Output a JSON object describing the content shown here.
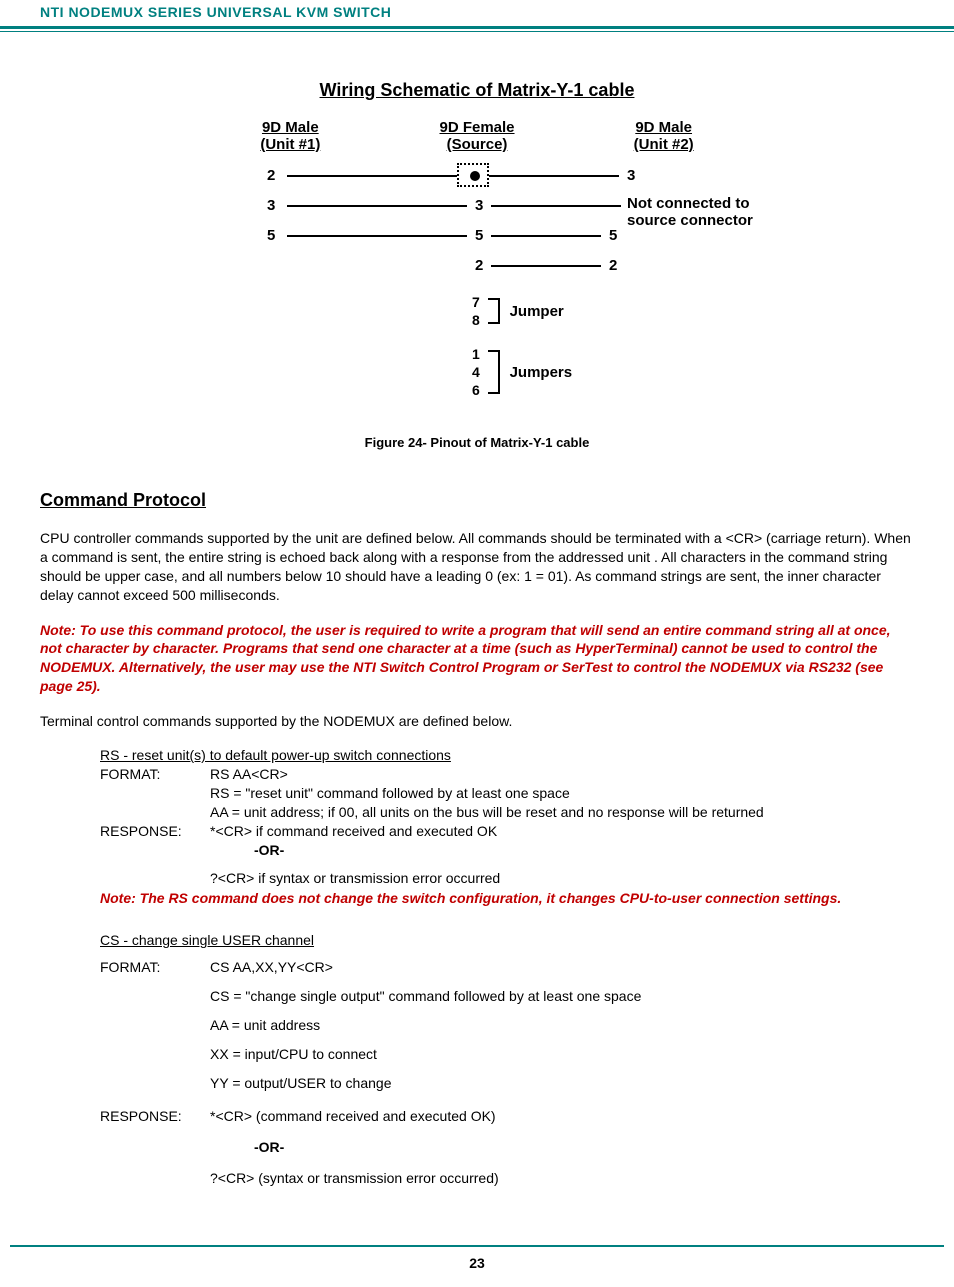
{
  "header": "NTI NODEMUX SERIES UNIVERSAL KVM SWITCH",
  "schematic": {
    "title": "Wiring Schematic of Matrix-Y-1 cable",
    "cols": {
      "c1a": "9D Male",
      "c1b": "(Unit #1)",
      "c2a": "9D Female",
      "c2b": "(Source)",
      "c3a": "9D Male",
      "c3b": "(Unit #2)"
    },
    "side_note_1": "Not connected to",
    "side_note_2": "source connector",
    "jumper1_label": "Jumper",
    "jumper2_label": "Jumpers",
    "pins": {
      "r1_l": "2",
      "r1_r": "3",
      "r2_l": "3",
      "r2_m": "3",
      "r3_l": "5",
      "r3_m": "5",
      "r3_r": "5",
      "r4_m": "2",
      "r4_r": "2",
      "j1a": "7",
      "j1b": "8",
      "j2a": "1",
      "j2b": "4",
      "j2c": "6"
    }
  },
  "figure_caption": "Figure 24- Pinout of Matrix-Y-1 cable",
  "section_title": "Command Protocol",
  "para1": "CPU controller commands supported by the unit are defined below. All commands should be terminated with a <CR> (carriage return). When a command is sent, the entire string is echoed back along with a response from the addressed unit . All characters in the command string should be upper case, and all numbers below 10 should have a leading 0 (ex: 1 = 01).  As command strings are sent, the inner character delay cannot exceed 500 milliseconds.",
  "note1": "Note: To use this command protocol, the user is required to write a program that will send an entire command string all at once, not character by character.  Programs that send one character at a time (such as HyperTerminal) cannot be used to control the NODEMUX.   Alternatively,  the user may use the NTI Switch Control Program or SerTest to control the NODEMUX via RS232 (see page 25).",
  "para2": "Terminal control commands supported by the NODEMUX are defined below.",
  "cmd_rs": {
    "title": "RS  -  reset unit(s) to default power-up switch connections",
    "format_label": "FORMAT:",
    "format_1": "RS  AA<CR>",
    "format_2": "RS = \"reset unit\" command followed by at least one space",
    "format_3": "AA = unit address; if 00, all units on the bus will be reset and no response will be returned",
    "response_label": "RESPONSE:",
    "response_1": "*<CR>  if command received and executed OK",
    "or": "-OR-",
    "response_2": "?<CR>  if syntax or transmission error occurred",
    "note": "Note: The RS command does not change the switch configuration, it changes CPU-to-user connection settings."
  },
  "cmd_cs": {
    "title": "CS  - change single USER channel",
    "format_label": "FORMAT:",
    "format_1": "CS  AA,XX,YY<CR>",
    "format_2": "CS = \"change single output\" command followed by at least one space",
    "format_3": "AA = unit address",
    "format_4": "XX = input/CPU to connect",
    "format_5": "YY = output/USER to change",
    "response_label": "RESPONSE:",
    "response_1": "*<CR>  (command received and executed OK)",
    "or": "-OR-",
    "response_2": "?<CR>   (syntax or transmission error occurred)"
  },
  "page_number": "23"
}
